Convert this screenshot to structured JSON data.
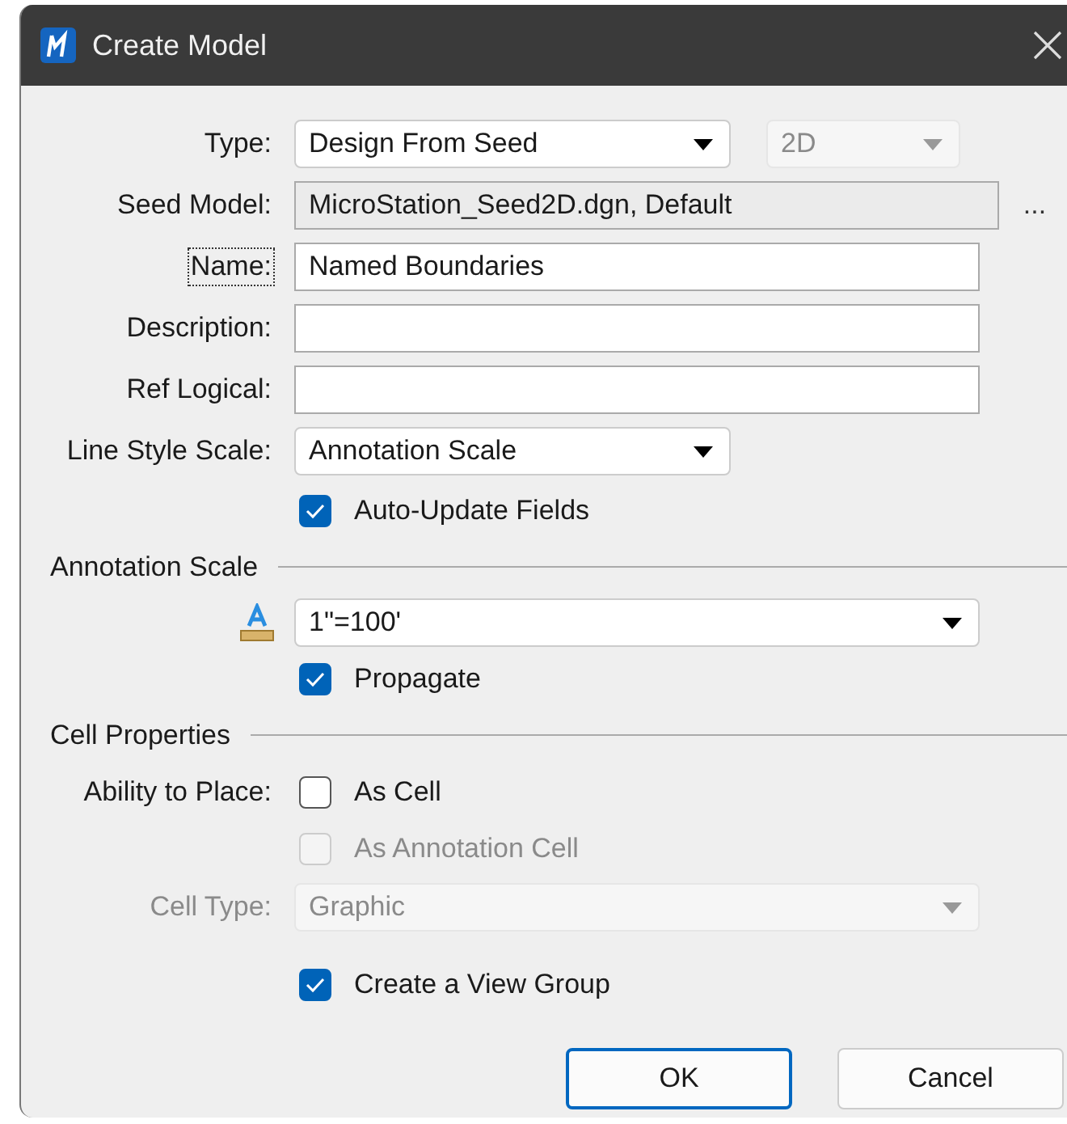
{
  "window": {
    "title": "Create Model"
  },
  "rows": [
    {
      "kind": "select",
      "label": "Type:",
      "value": "Design From Seed",
      "compact": true,
      "secondary": {
        "value": "2D",
        "disabled": true
      }
    },
    {
      "kind": "readonly",
      "label": "Seed Model:",
      "value": "MicroStation_Seed2D.dgn, Default",
      "browse": "..."
    },
    {
      "kind": "text",
      "label": "Name:",
      "value": "Named Boundaries",
      "focused": true
    },
    {
      "kind": "text",
      "label": "Description:"
    },
    {
      "kind": "text",
      "label": "Ref Logical:"
    },
    {
      "kind": "select",
      "label": "Line Style Scale:",
      "value": "Annotation Scale",
      "compact": true
    },
    {
      "kind": "checkbox",
      "label": "Auto-Update Fields",
      "checked": true,
      "disabled": false
    },
    {
      "kind": "section",
      "label": "Annotation Scale"
    },
    {
      "kind": "icon-select",
      "value": "1\"=100'"
    },
    {
      "kind": "checkbox",
      "label": "Propagate",
      "checked": true,
      "disabled": false
    },
    {
      "kind": "section",
      "label": "Cell Properties"
    },
    {
      "kind": "checkbox",
      "caption": "Ability to Place:",
      "label": "As Cell",
      "checked": false,
      "disabled": false
    },
    {
      "kind": "checkbox",
      "label": "As Annotation Cell",
      "checked": false,
      "disabled": true
    },
    {
      "kind": "select",
      "label": "Cell Type:",
      "value": "Graphic",
      "disabled": true
    },
    {
      "kind": "checkbox",
      "label": "Create a View Group",
      "checked": true,
      "disabled": false,
      "spaced": true
    }
  ],
  "buttons": [
    {
      "label": "OK",
      "default": true
    },
    {
      "label": "Cancel",
      "default": false
    }
  ]
}
